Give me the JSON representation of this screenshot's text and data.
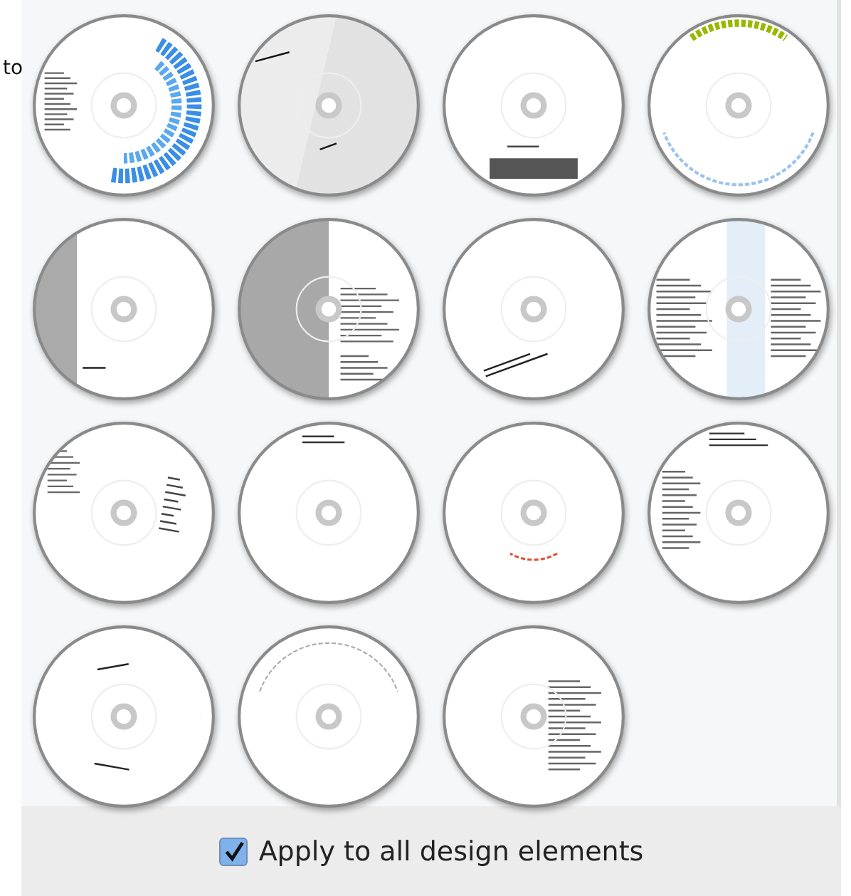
{
  "side_label": "to",
  "layouts": [
    {
      "kind": "arc-blue"
    },
    {
      "kind": "diagonal-grey"
    },
    {
      "kind": "band-dark"
    },
    {
      "kind": "arc-green"
    },
    {
      "kind": "side-grey"
    },
    {
      "kind": "side-dark"
    },
    {
      "kind": "diagonal-text"
    },
    {
      "kind": "column-blue"
    },
    {
      "kind": "lines-left"
    },
    {
      "kind": "top-text"
    },
    {
      "kind": "arc-red"
    },
    {
      "kind": "top-block"
    },
    {
      "kind": "ring-text"
    },
    {
      "kind": "ring-thin"
    },
    {
      "kind": "right-column"
    }
  ],
  "apply_all": {
    "label": "Apply to all design elements",
    "checked": true
  }
}
